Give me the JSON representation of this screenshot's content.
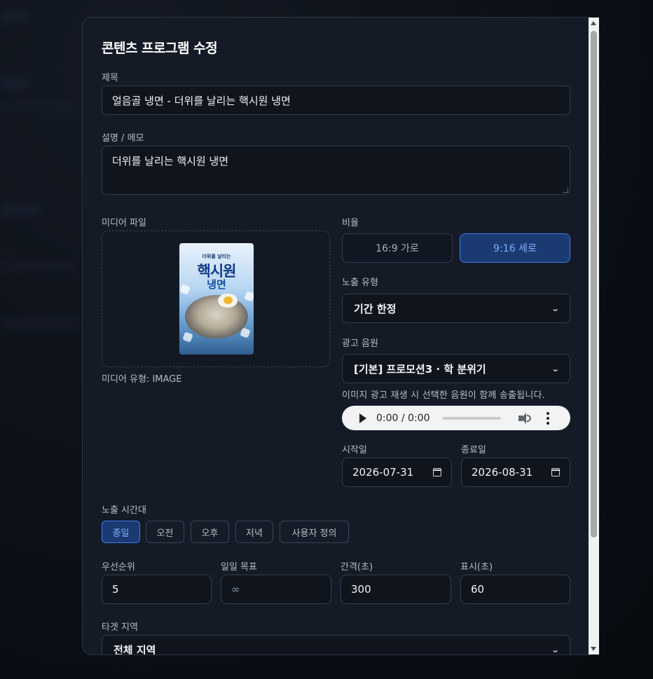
{
  "modal": {
    "title": "콘텐츠 프로그램 수정"
  },
  "title_field": {
    "label": "제목",
    "value": "얼음골 냉면 - 더위를 날리는 핵시원 냉면"
  },
  "description_field": {
    "label": "설명 / 메모",
    "value": "더위를 날리는 핵시원 냉면"
  },
  "media": {
    "label": "미디어 파일",
    "type_text": "미디어 유형: IMAGE",
    "poster": {
      "subtitle": "더위를 날리는",
      "line1": "핵시원",
      "line2": "냉면"
    }
  },
  "ratio": {
    "label": "비율",
    "options": [
      {
        "label": "16:9 가로",
        "selected": false
      },
      {
        "label": "9:16 세로",
        "selected": true
      }
    ]
  },
  "exposure_type": {
    "label": "노출 유형",
    "value": "기간 한정"
  },
  "ad_audio": {
    "label": "광고 음원",
    "value": "[기본] 프로모션3 · 학 분위기",
    "hint": "이미지 광고 재생 시 선택한 음원이 함께 송출됩니다.",
    "player_time": "0:00 / 0:00"
  },
  "start_date": {
    "label": "시작일",
    "value": "2026-07-31"
  },
  "end_date": {
    "label": "종료일",
    "value": "2026-08-31"
  },
  "time_slot": {
    "label": "노출 시간대",
    "options": [
      {
        "label": "종일",
        "selected": true
      },
      {
        "label": "오전",
        "selected": false
      },
      {
        "label": "오후",
        "selected": false
      },
      {
        "label": "저녁",
        "selected": false
      },
      {
        "label": "사용자 정의",
        "selected": false
      }
    ]
  },
  "priority": {
    "label": "우선순위",
    "value": "5"
  },
  "daily_goal": {
    "label": "일일 목표",
    "placeholder": "∞"
  },
  "interval": {
    "label": "간격(초)",
    "value": "300"
  },
  "display": {
    "label": "표시(초)",
    "value": "60"
  },
  "target_region": {
    "label": "타겟 지역",
    "value": "전체 지역"
  },
  "colors": {
    "accent": "#3c7af0",
    "surface": "#151b26",
    "field_bg": "#0f141d"
  }
}
